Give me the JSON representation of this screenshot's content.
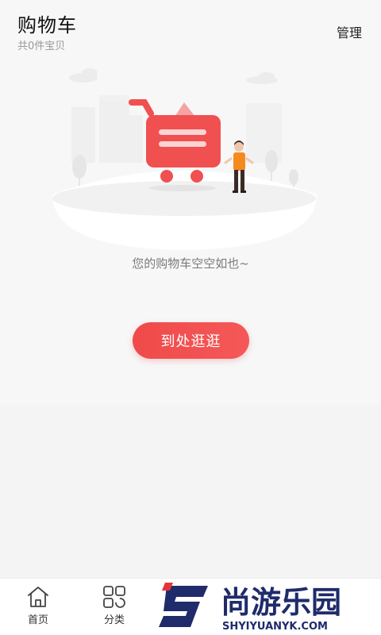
{
  "header": {
    "title": "购物车",
    "subtitle": "共0件宝贝",
    "manage_label": "管理"
  },
  "empty_state": {
    "message": "您的购物车空空如也~",
    "button_label": "到处逛逛"
  },
  "tabbar": {
    "items": [
      {
        "label": "首页",
        "icon": "home-icon"
      },
      {
        "label": "分类",
        "icon": "grid-icon"
      }
    ]
  },
  "watermark": {
    "title": "尚游乐园",
    "url": "SHYIYUANYK.COM"
  },
  "colors": {
    "accent": "#f04a4a",
    "background": "#f4f4f4"
  }
}
